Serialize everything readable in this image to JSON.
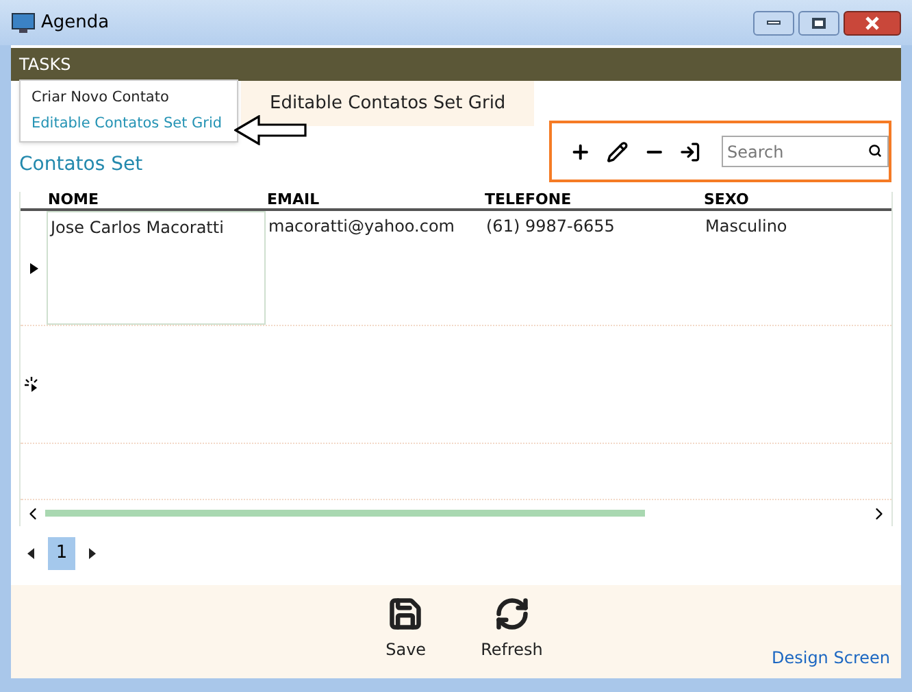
{
  "window": {
    "title": "Agenda"
  },
  "tasks_bar": {
    "label": "TASKS"
  },
  "tasks_menu": {
    "items": [
      {
        "label": "Criar Novo Contato",
        "selected": false
      },
      {
        "label": "Editable Contatos Set Grid",
        "selected": true
      }
    ]
  },
  "tabs": [
    {
      "label": "Editable Contatos Set Grid",
      "selected": true
    }
  ],
  "section_title": "Contatos Set",
  "toolbar": {
    "buttons": [
      {
        "kind": "add"
      },
      {
        "kind": "edit"
      },
      {
        "kind": "remove"
      },
      {
        "kind": "export"
      }
    ],
    "search": {
      "placeholder": "Search"
    }
  },
  "grid": {
    "columns": [
      "NOME",
      "EMAIL",
      "TELEFONE",
      "SEXO"
    ],
    "rows": [
      {
        "cells": [
          "Jose Carlos Macoratti",
          "macoratti@yahoo.com",
          "(61) 9987-6655",
          "Masculino"
        ],
        "selected": true
      }
    ]
  },
  "pager": {
    "pages": [
      {
        "label": "1",
        "selected": true
      }
    ]
  },
  "footer": {
    "buttons": [
      {
        "label": "Save",
        "kind": "save"
      },
      {
        "label": "Refresh",
        "kind": "refresh"
      }
    ],
    "link": "Design Screen"
  }
}
